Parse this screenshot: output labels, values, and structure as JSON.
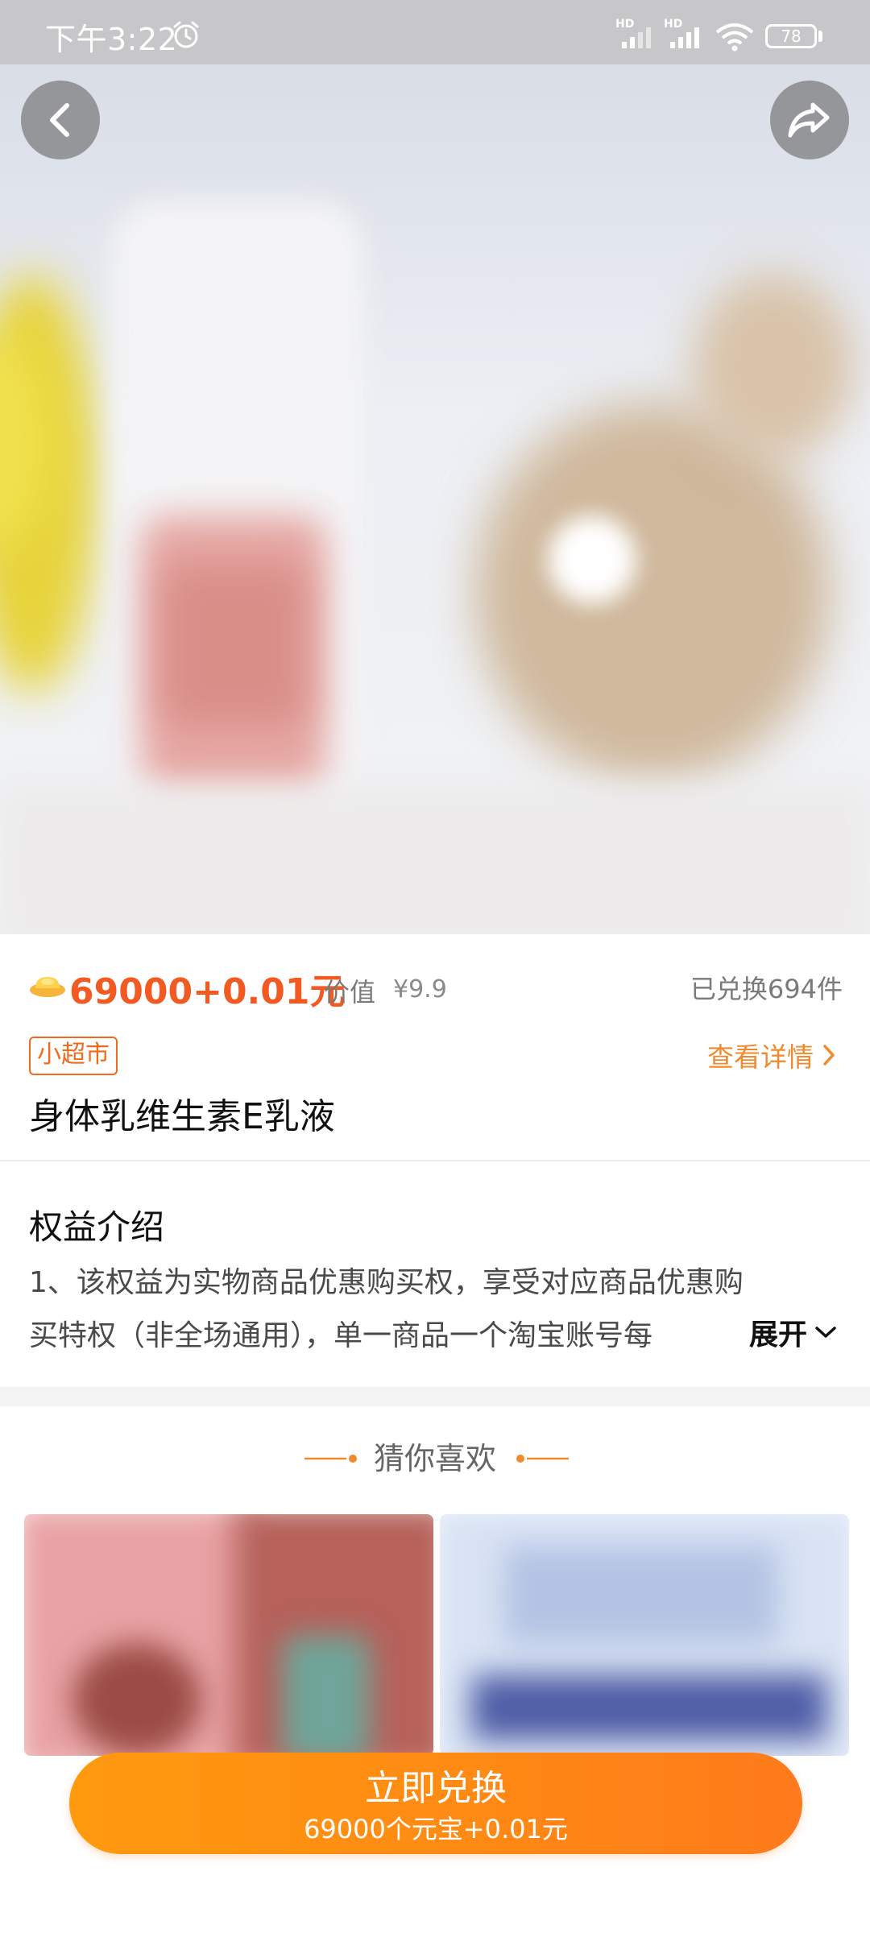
{
  "status_bar": {
    "time": "下午3:22",
    "signal_label_1": "HD",
    "signal_label_2": "HD",
    "battery": "78"
  },
  "nav": {
    "back_icon": "chevron-left-icon",
    "share_icon": "share-arrow-icon"
  },
  "product": {
    "price": "69000+0.01元",
    "worth_label": "价值",
    "worth_value": "¥9.9",
    "redeemed": "已兑换694件",
    "tag": "小超市",
    "details_link": "查看详情",
    "title": "身体乳维生素E乳液"
  },
  "benefits": {
    "title": "权益介绍",
    "line1": "1、该权益为实物商品优惠购买权，享受对应商品优惠购",
    "line2": "买特权（非全场通用），单一商品一个淘宝账号每",
    "expand_label": "展开"
  },
  "recommend": {
    "title": "猜你喜欢"
  },
  "cta": {
    "label": "立即兑换",
    "sublabel": "69000个元宝+0.01元"
  },
  "colors": {
    "accent": "#f25a21",
    "orange_link": "#f08a2c",
    "cta": "#ff8a14"
  }
}
